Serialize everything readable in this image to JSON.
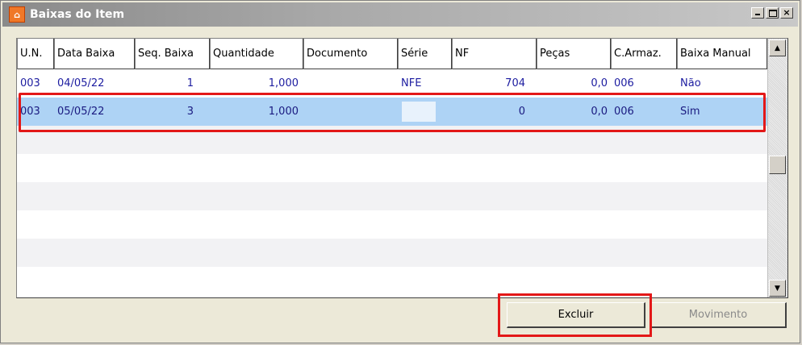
{
  "window": {
    "title": "Baixas do Item",
    "icon": "app-logo-icon",
    "title_bar_color": "#8a8a8a"
  },
  "grid": {
    "columns": [
      "U.N.",
      "Data Baixa",
      "Seq. Baixa",
      "Quantidade",
      "Documento",
      "Série",
      "NF",
      "Peças",
      "C.Armaz.",
      "Baixa Manual"
    ],
    "rows": [
      {
        "un": "003",
        "data": "04/05/22",
        "seq": "1",
        "qtd": "1,000",
        "doc": "",
        "serie": "NFE",
        "nf": "704",
        "pecas": "0,0",
        "armaz": "006",
        "manual": "Não"
      },
      {
        "un": "003",
        "data": "05/05/22",
        "seq": "3",
        "qtd": "1,000",
        "doc": "",
        "serie": "",
        "nf": "0",
        "pecas": "0,0",
        "armaz": "006",
        "manual": "Sim"
      }
    ],
    "text_color": "#1c1ca0",
    "selected_color": "#aed3f5",
    "highlight_color": "#e31818"
  },
  "buttons": {
    "excluir": "Excluir",
    "movimento": "Movimento"
  }
}
